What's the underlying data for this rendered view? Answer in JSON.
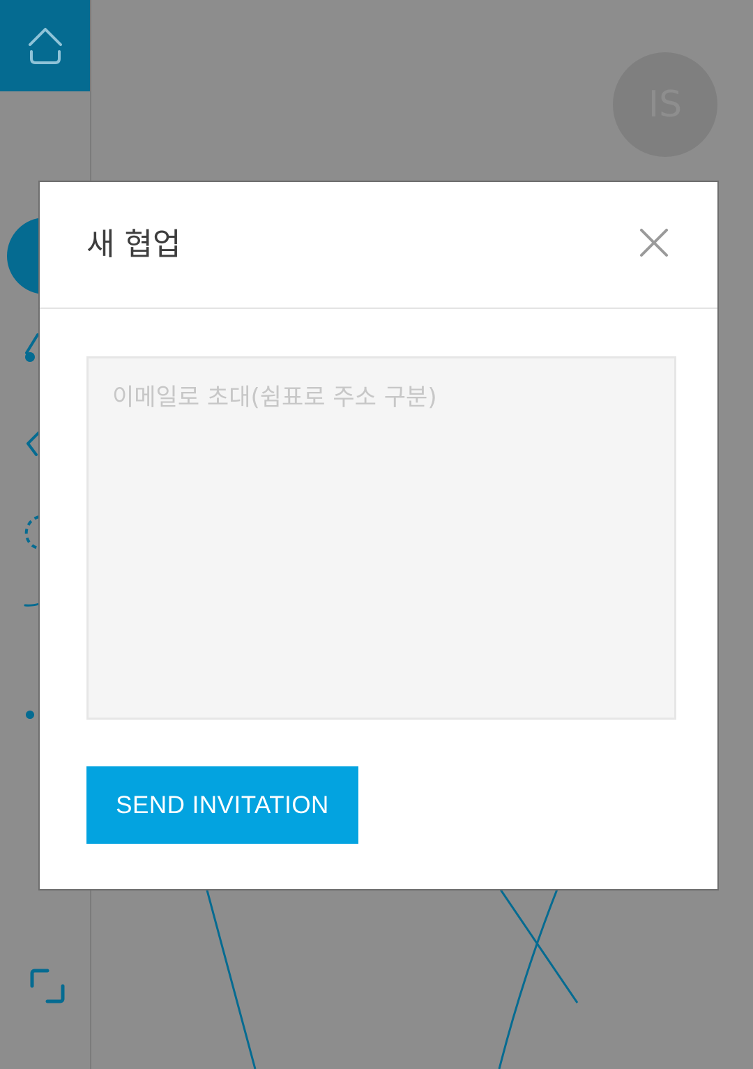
{
  "app": {
    "user_initials": "IS",
    "accent_color": "#056b91",
    "icons": [
      "home-icon",
      "shape-tool-icon",
      "pen-tool-icon",
      "eraser-tool-icon",
      "lasso-tool-icon",
      "line-tool-icon",
      "dot-tool-icon",
      "crop-icon"
    ]
  },
  "modal": {
    "title": "새 협업",
    "close_icon": "close-icon",
    "email_placeholder": "이메일로 초대(쉼표로 주소 구분)",
    "email_value": "",
    "send_label": "SEND INVITATION",
    "send_color": "#03a3e0"
  }
}
